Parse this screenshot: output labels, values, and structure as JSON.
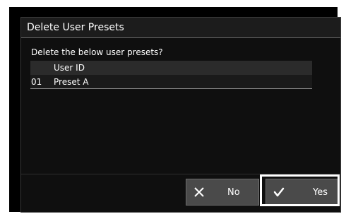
{
  "dialog": {
    "title": "Delete User Presets",
    "prompt": "Delete the below user presets?"
  },
  "table": {
    "header": "User ID",
    "rows": [
      {
        "num": "01",
        "name": "Preset A"
      }
    ]
  },
  "buttons": {
    "no_label": "No",
    "yes_label": "Yes",
    "no_icon": "close-icon",
    "yes_icon": "checkmark-icon",
    "selected": "Yes"
  },
  "colors": {
    "dialog_bg": "#0f0f0f",
    "button_bg": "#4a4a4a",
    "text": "#ffffff",
    "highlight": "#ffffff"
  }
}
